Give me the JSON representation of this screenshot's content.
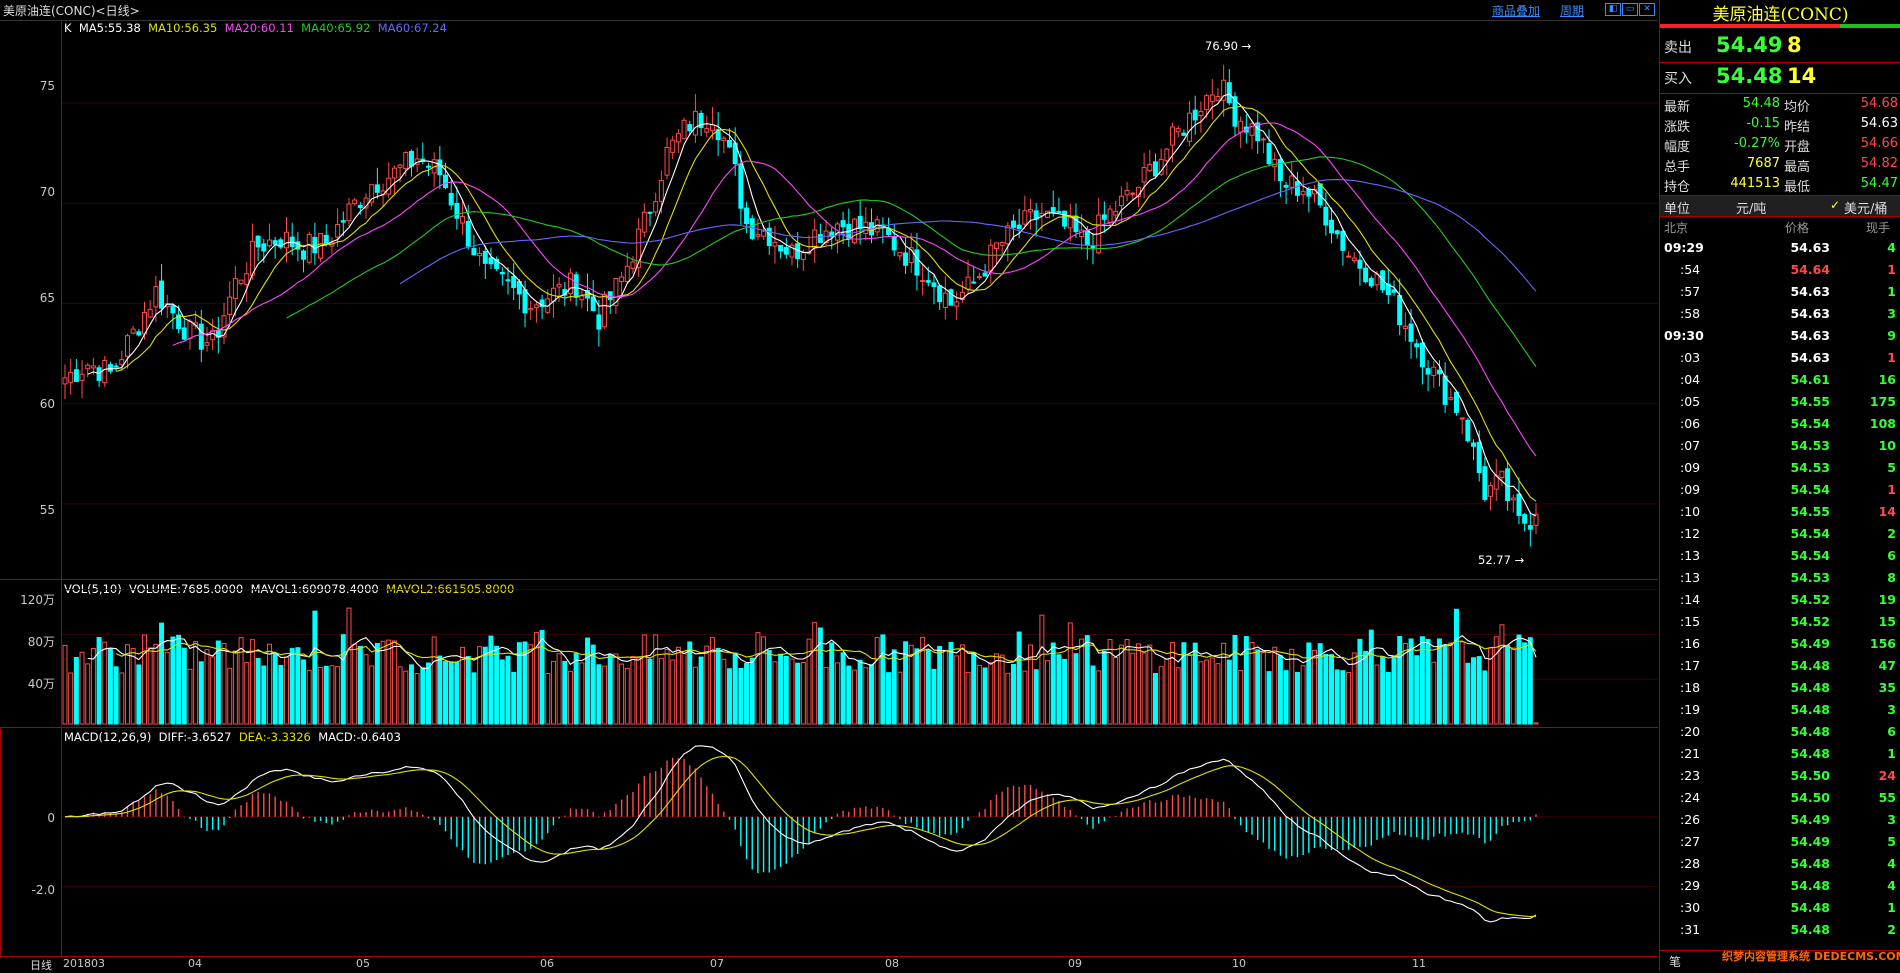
{
  "window": {
    "title": "美原油连(CONC)<日线>",
    "links": [
      "商品叠加",
      "周期"
    ],
    "win_buttons": [
      "◧",
      "▭",
      "✕"
    ]
  },
  "colors": {
    "up": "#ff4a4a",
    "down": "#00ffff",
    "ma5": "#ffffff",
    "ma10": "#e0e000",
    "ma20": "#ff44ff",
    "ma40": "#22cc22",
    "ma60": "#6666ff",
    "frame": "#aa0000"
  },
  "kline": {
    "legend": [
      {
        "text": "K",
        "color": "#ffffff"
      },
      {
        "text": "MA5:55.38",
        "color": "#ffffff"
      },
      {
        "text": "MA10:56.35",
        "color": "#e0e000"
      },
      {
        "text": "MA20:60.11",
        "color": "#ff44ff"
      },
      {
        "text": "MA40:65.92",
        "color": "#22cc22"
      },
      {
        "text": "MA60:67.24",
        "color": "#6666ff"
      }
    ],
    "y_ticks": [
      "75",
      "70",
      "65",
      "60",
      "55"
    ],
    "high_marker": "76.90",
    "low_marker": "52.77"
  },
  "volume": {
    "legend": [
      {
        "text": "VOL(5,10)",
        "color": "#ffffff"
      },
      {
        "text": "VOLUME:7685.0000",
        "color": "#ffffff"
      },
      {
        "text": "MAVOL1:609078.4000",
        "color": "#ffffff"
      },
      {
        "text": "MAVOL2:661505.8000",
        "color": "#e0e000"
      }
    ],
    "y_ticks": [
      "120万",
      "80万",
      "40万"
    ]
  },
  "macd": {
    "legend": [
      {
        "text": "MACD(12,26,9)",
        "color": "#ffffff"
      },
      {
        "text": "DIFF:-3.6527",
        "color": "#ffffff"
      },
      {
        "text": "DEA:-3.3326",
        "color": "#e0e000"
      },
      {
        "text": "MACD:-0.6403",
        "color": "#ffffff"
      }
    ],
    "y_ticks": [
      "0",
      "-2.0"
    ]
  },
  "x_axis": {
    "period_label": "日线",
    "labels": [
      "201803",
      "04",
      "05",
      "06",
      "07",
      "08",
      "09",
      "10",
      "11"
    ]
  },
  "chart_data": {
    "type": "candlestick",
    "title": "美原油连(CONC)<日线>",
    "ylim": [
      51.5,
      78.5
    ],
    "x_labels": [
      "201803",
      "04",
      "05",
      "06",
      "07",
      "08",
      "09",
      "10",
      "11"
    ],
    "anchors": [
      [
        0,
        61.3
      ],
      [
        4,
        62.0
      ],
      [
        8,
        61.5
      ],
      [
        12,
        63.5
      ],
      [
        16,
        65.6
      ],
      [
        22,
        63.5
      ],
      [
        26,
        63.0
      ],
      [
        30,
        66.0
      ],
      [
        34,
        67.9
      ],
      [
        38,
        68.3
      ],
      [
        42,
        67.8
      ],
      [
        46,
        68.0
      ],
      [
        50,
        69.6
      ],
      [
        54,
        71.0
      ],
      [
        58,
        71.5
      ],
      [
        62,
        72.3
      ],
      [
        66,
        71.5
      ],
      [
        70,
        69.0
      ],
      [
        74,
        66.5
      ],
      [
        78,
        65.8
      ],
      [
        82,
        65.0
      ],
      [
        86,
        65.5
      ],
      [
        90,
        66.0
      ],
      [
        94,
        64.3
      ],
      [
        98,
        66.2
      ],
      [
        102,
        69.0
      ],
      [
        106,
        72.5
      ],
      [
        110,
        74.0
      ],
      [
        114,
        74.5
      ],
      [
        116,
        73.2
      ],
      [
        118,
        71.5
      ],
      [
        120,
        69.0
      ],
      [
        124,
        68.5
      ],
      [
        128,
        67.5
      ],
      [
        132,
        68.5
      ],
      [
        136,
        69.0
      ],
      [
        140,
        68.8
      ],
      [
        144,
        68.5
      ],
      [
        148,
        67.5
      ],
      [
        152,
        66.5
      ],
      [
        156,
        65.0
      ],
      [
        160,
        66.0
      ],
      [
        164,
        67.8
      ],
      [
        168,
        68.8
      ],
      [
        172,
        69.5
      ],
      [
        176,
        68.8
      ],
      [
        180,
        68.0
      ],
      [
        184,
        69.5
      ],
      [
        188,
        70.5
      ],
      [
        192,
        72.0
      ],
      [
        196,
        73.5
      ],
      [
        200,
        75.0
      ],
      [
        203,
        76.0
      ],
      [
        206,
        74.5
      ],
      [
        210,
        73.5
      ],
      [
        214,
        71.0
      ],
      [
        218,
        70.8
      ],
      [
        222,
        69.5
      ],
      [
        226,
        67.5
      ],
      [
        230,
        66.5
      ],
      [
        234,
        65.0
      ],
      [
        238,
        63.0
      ],
      [
        242,
        61.0
      ],
      [
        246,
        59.5
      ],
      [
        250,
        55.6
      ],
      [
        253,
        56.0
      ],
      [
        256,
        54.0
      ],
      [
        259,
        54.48
      ]
    ],
    "volume_units": "万",
    "volume_ylim": [
      0,
      125
    ],
    "macd_ylim": [
      -3.9,
      2.4
    ],
    "summary": {
      "high": 76.9,
      "low": 52.77,
      "last": 54.48
    }
  },
  "quote": {
    "name": "美原油连(CONC)",
    "sell": {
      "label": "卖出",
      "price": "54.49",
      "qty": "8"
    },
    "buy": {
      "label": "买入",
      "price": "54.48",
      "qty": "14"
    },
    "stats": [
      {
        "l1": "最新",
        "v1": "54.48",
        "c1": "green",
        "l2": "均价",
        "v2": "54.68",
        "c2": "red"
      },
      {
        "l1": "涨跌",
        "v1": "-0.15",
        "c1": "green",
        "l2": "昨结",
        "v2": "54.63",
        "c2": "white"
      },
      {
        "l1": "幅度",
        "v1": "-0.27%",
        "c1": "green",
        "l2": "开盘",
        "v2": "54.66",
        "c2": "red"
      },
      {
        "l1": "总手",
        "v1": "7687",
        "c1": "yellow",
        "l2": "最高",
        "v2": "54.82",
        "c2": "red"
      },
      {
        "l1": "持仓",
        "v1": "441513",
        "c1": "yellow",
        "l2": "最低",
        "v2": "54.47",
        "c2": "green"
      }
    ],
    "unit": {
      "label": "单位",
      "option1": "元/吨",
      "option2": "美元/桶"
    },
    "ticks_header": {
      "time": "北京",
      "price": "价格",
      "qty": "现手"
    },
    "ticks": [
      {
        "t": "09:29",
        "p": "54.63",
        "q": "4",
        "pc": "white",
        "qc": "green",
        "big": true
      },
      {
        "t": ":54",
        "p": "54.64",
        "q": "1",
        "pc": "red",
        "qc": "red"
      },
      {
        "t": ":57",
        "p": "54.63",
        "q": "1",
        "pc": "white",
        "qc": "green"
      },
      {
        "t": ":58",
        "p": "54.63",
        "q": "3",
        "pc": "white",
        "qc": "green"
      },
      {
        "t": "09:30",
        "p": "54.63",
        "q": "9",
        "pc": "white",
        "qc": "green",
        "big": true
      },
      {
        "t": ":03",
        "p": "54.63",
        "q": "1",
        "pc": "white",
        "qc": "red"
      },
      {
        "t": ":04",
        "p": "54.61",
        "q": "16",
        "pc": "green",
        "qc": "green"
      },
      {
        "t": ":05",
        "p": "54.55",
        "q": "175",
        "pc": "green",
        "qc": "green"
      },
      {
        "t": ":06",
        "p": "54.54",
        "q": "108",
        "pc": "green",
        "qc": "green"
      },
      {
        "t": ":07",
        "p": "54.53",
        "q": "10",
        "pc": "green",
        "qc": "green"
      },
      {
        "t": ":09",
        "p": "54.53",
        "q": "5",
        "pc": "green",
        "qc": "green"
      },
      {
        "t": ":09",
        "p": "54.54",
        "q": "1",
        "pc": "green",
        "qc": "red"
      },
      {
        "t": ":10",
        "p": "54.55",
        "q": "14",
        "pc": "green",
        "qc": "red"
      },
      {
        "t": ":12",
        "p": "54.54",
        "q": "2",
        "pc": "green",
        "qc": "green"
      },
      {
        "t": ":13",
        "p": "54.54",
        "q": "6",
        "pc": "green",
        "qc": "green"
      },
      {
        "t": ":13",
        "p": "54.53",
        "q": "8",
        "pc": "green",
        "qc": "green"
      },
      {
        "t": ":14",
        "p": "54.52",
        "q": "19",
        "pc": "green",
        "qc": "green"
      },
      {
        "t": ":15",
        "p": "54.52",
        "q": "15",
        "pc": "green",
        "qc": "green"
      },
      {
        "t": ":16",
        "p": "54.49",
        "q": "156",
        "pc": "green",
        "qc": "green"
      },
      {
        "t": ":17",
        "p": "54.48",
        "q": "47",
        "pc": "green",
        "qc": "green"
      },
      {
        "t": ":18",
        "p": "54.48",
        "q": "35",
        "pc": "green",
        "qc": "green"
      },
      {
        "t": ":19",
        "p": "54.48",
        "q": "3",
        "pc": "green",
        "qc": "green"
      },
      {
        "t": ":20",
        "p": "54.48",
        "q": "6",
        "pc": "green",
        "qc": "green"
      },
      {
        "t": ":21",
        "p": "54.48",
        "q": "1",
        "pc": "green",
        "qc": "green"
      },
      {
        "t": ":23",
        "p": "54.50",
        "q": "24",
        "pc": "green",
        "qc": "red"
      },
      {
        "t": ":24",
        "p": "54.50",
        "q": "55",
        "pc": "green",
        "qc": "green"
      },
      {
        "t": ":26",
        "p": "54.49",
        "q": "3",
        "pc": "green",
        "qc": "green"
      },
      {
        "t": ":27",
        "p": "54.49",
        "q": "5",
        "pc": "green",
        "qc": "green"
      },
      {
        "t": ":28",
        "p": "54.48",
        "q": "4",
        "pc": "green",
        "qc": "green"
      },
      {
        "t": ":29",
        "p": "54.48",
        "q": "4",
        "pc": "green",
        "qc": "green"
      },
      {
        "t": ":30",
        "p": "54.48",
        "q": "1",
        "pc": "green",
        "qc": "green"
      },
      {
        "t": ":31",
        "p": "54.48",
        "q": "2",
        "pc": "green",
        "qc": "green"
      }
    ],
    "bottom_tab": "笔",
    "watermark": "织梦内容管理系统 DEDECMS.COM"
  }
}
